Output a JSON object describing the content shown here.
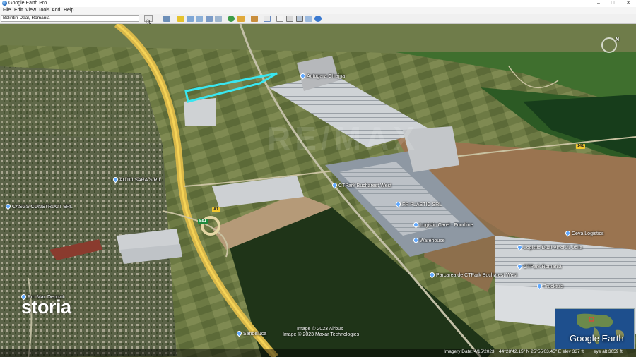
{
  "window": {
    "title": "Google Earth Pro",
    "minimize": "–",
    "maximize": "□",
    "close": "✕"
  },
  "menu": [
    "File",
    "Edit",
    "View",
    "Tools",
    "Add",
    "Help"
  ],
  "search": {
    "value": "Bolintin-Deal, Romania"
  },
  "toolbar_icons": [
    "sidebar-toggle-icon",
    "placemark-icon",
    "polygon-icon",
    "path-icon",
    "image-overlay-icon",
    "record-tour-icon",
    "historical-imagery-icon",
    "sunlight-icon",
    "planets-icon",
    "ruler-icon",
    "email-icon",
    "print-icon",
    "save-image-icon",
    "view-in-maps-icon",
    "sign-in-icon"
  ],
  "map": {
    "labels": [
      {
        "text": "AUTO SARA S.R.L."
      },
      {
        "text": "CASGS CONSTRUCT SRL"
      },
      {
        "text": "Pro Mac Depozit"
      },
      {
        "text": "Sandeluca"
      },
      {
        "text": "FR PLASTIC SRL"
      },
      {
        "text": "Logistic Carel - Foodline"
      },
      {
        "text": "Warehouse"
      },
      {
        "text": "Parcarea de CTPark Bucharest West"
      },
      {
        "text": "Logistic Dual Vinci 21 Jolia"
      },
      {
        "text": "Trucktuls"
      },
      {
        "text": "Ceva Logistics"
      },
      {
        "text": "CTPark Romania"
      },
      {
        "text": "Autogara Chiajna"
      },
      {
        "text": "CTPark Bucharest West"
      }
    ],
    "road_shields": [
      {
        "text": "A1"
      },
      {
        "text": "E81"
      },
      {
        "text": "141"
      }
    ],
    "watermark": "RE/MAX",
    "brand_overlay": "storia",
    "credits": [
      "Image © 2023 Airbus",
      "Image © 2023 Maxar Technologies"
    ],
    "status": {
      "imagery_date": "Imagery Date: 4/15/2023",
      "coords": "44°28'42.15\" N  25°55'03.45\" E  elev 337 ft",
      "eye_alt": "eye alt 3059 ft"
    },
    "logo": "Google Earth",
    "compass_n": "N",
    "highlight_color": "#39e6f0"
  }
}
